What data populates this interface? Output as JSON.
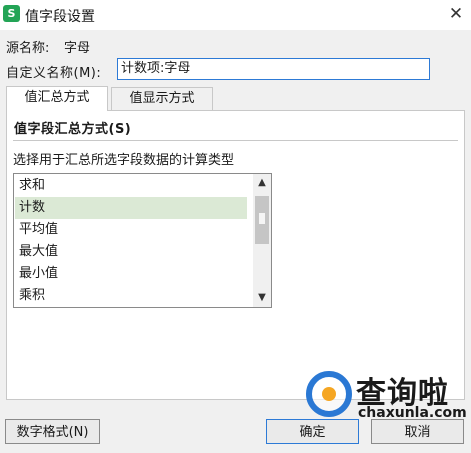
{
  "window": {
    "title": "值字段设置",
    "app_icon_letter": "S",
    "close_glyph": "✕"
  },
  "source_name": {
    "label": "源名称:",
    "value": "字母"
  },
  "custom_name": {
    "label": "自定义名称(M):",
    "value": "计数项:字母"
  },
  "tabs": [
    {
      "label": "值汇总方式",
      "active": true
    },
    {
      "label": "值显示方式",
      "active": false
    }
  ],
  "summary_section": {
    "title": "值字段汇总方式(S)",
    "caption": "选择用于汇总所选字段数据的计算类型",
    "items": [
      "求和",
      "计数",
      "平均值",
      "最大值",
      "最小值",
      "乘积"
    ],
    "selected_index": 1
  },
  "buttons": {
    "number_format": "数字格式(N)",
    "ok": "确定",
    "cancel": "取消"
  },
  "watermark": {
    "logo_text": "查询啦",
    "url_text": "chaxunla.com"
  },
  "colors": {
    "selected_row": "#dbe9d5",
    "focus_border": "#2d7ad6",
    "app_icon": "#23a456"
  }
}
